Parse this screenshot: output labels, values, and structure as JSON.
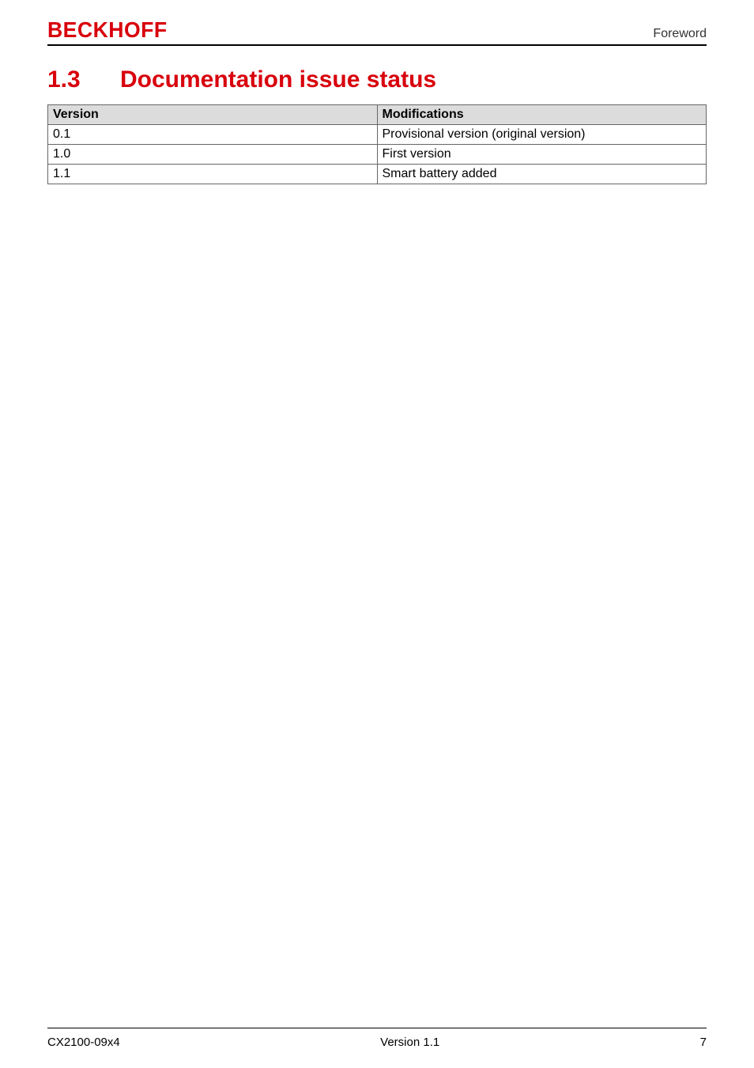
{
  "header": {
    "logo": "BECKHOFF",
    "breadcrumb": "Foreword"
  },
  "heading": {
    "number": "1.3",
    "title": "Documentation issue status"
  },
  "table": {
    "headers": {
      "col1": "Version",
      "col2": "Modifications"
    },
    "rows": [
      {
        "c1": "0.1",
        "c2": "Provisional version (original version)"
      },
      {
        "c1": "1.0",
        "c2": "First version"
      },
      {
        "c1": "1.1",
        "c2": "Smart battery added"
      }
    ]
  },
  "footer": {
    "left": "CX2100-09x4",
    "center": "Version 1.1",
    "right": "7"
  }
}
